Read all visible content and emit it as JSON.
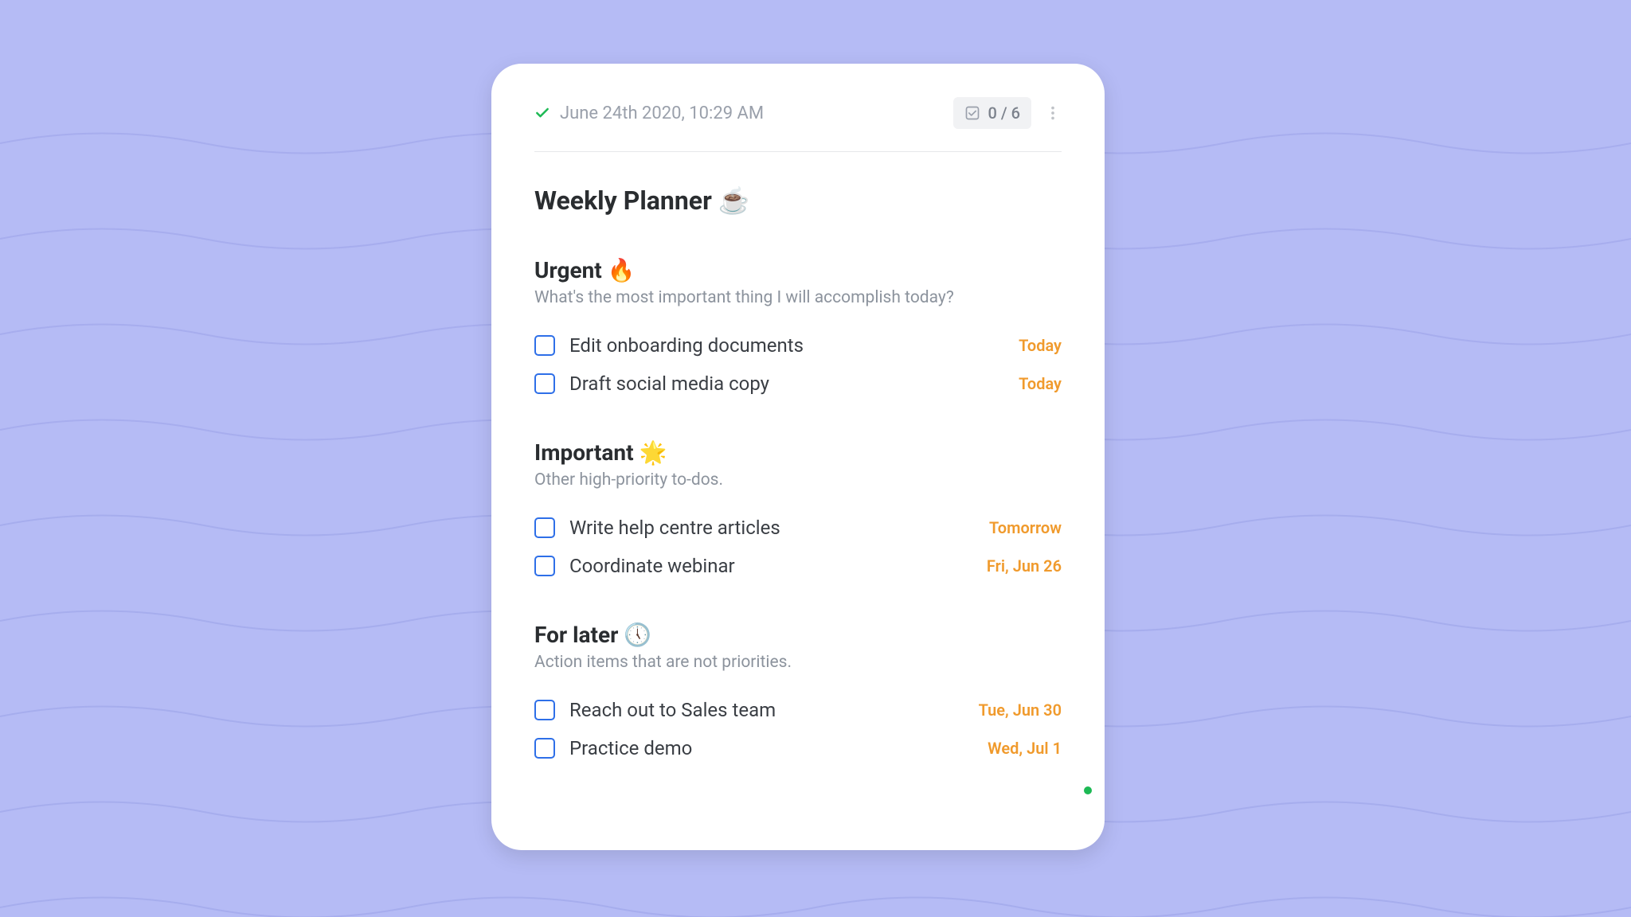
{
  "header": {
    "timestamp": "June 24th 2020, 10:29 AM",
    "counter": "0 / 6"
  },
  "title": "Weekly Planner ☕",
  "sections": [
    {
      "title": "Urgent 🔥",
      "subtitle": "What's the most important thing I will accomplish today?",
      "tasks": [
        {
          "label": "Edit onboarding documents",
          "due": "Today"
        },
        {
          "label": "Draft social media copy",
          "due": "Today"
        }
      ]
    },
    {
      "title": "Important 🌟",
      "subtitle": "Other high-priority to-dos.",
      "tasks": [
        {
          "label": "Write help centre articles",
          "due": "Tomorrow"
        },
        {
          "label": "Coordinate webinar",
          "due": "Fri, Jun 26"
        }
      ]
    },
    {
      "title": "For later 🕔",
      "subtitle": "Action items that are not priorities.",
      "tasks": [
        {
          "label": "Reach out to Sales team",
          "due": "Tue, Jun 30"
        },
        {
          "label": "Practice demo",
          "due": "Wed, Jul 1"
        }
      ]
    }
  ]
}
